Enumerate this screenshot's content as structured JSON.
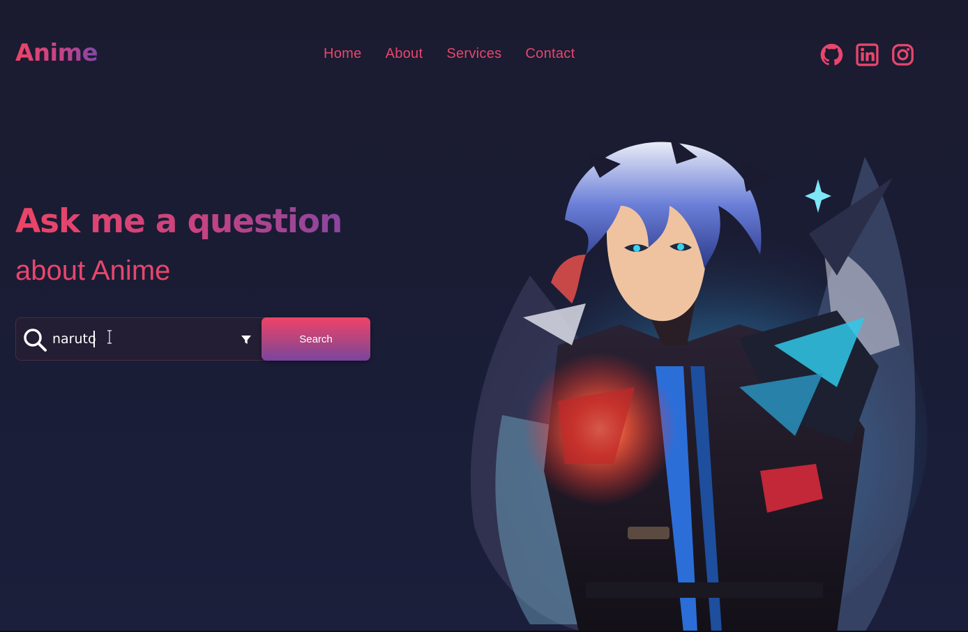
{
  "header": {
    "logo": "Anime",
    "nav": [
      "Home",
      "About",
      "Services",
      "Contact"
    ],
    "socials": [
      "github-icon",
      "linkedin-icon",
      "instagram-icon"
    ]
  },
  "hero": {
    "headline": "Ask me a question",
    "subheadline": "about Anime"
  },
  "search": {
    "value": "naruto",
    "button_label": "Search"
  },
  "colors": {
    "background": "#1b1d36",
    "accent_pink": "#e8466d",
    "accent_purple": "#7a45a0",
    "text_white": "#ffffff"
  },
  "icons": [
    "search-icon",
    "filter-icon",
    "text-cursor-icon"
  ]
}
